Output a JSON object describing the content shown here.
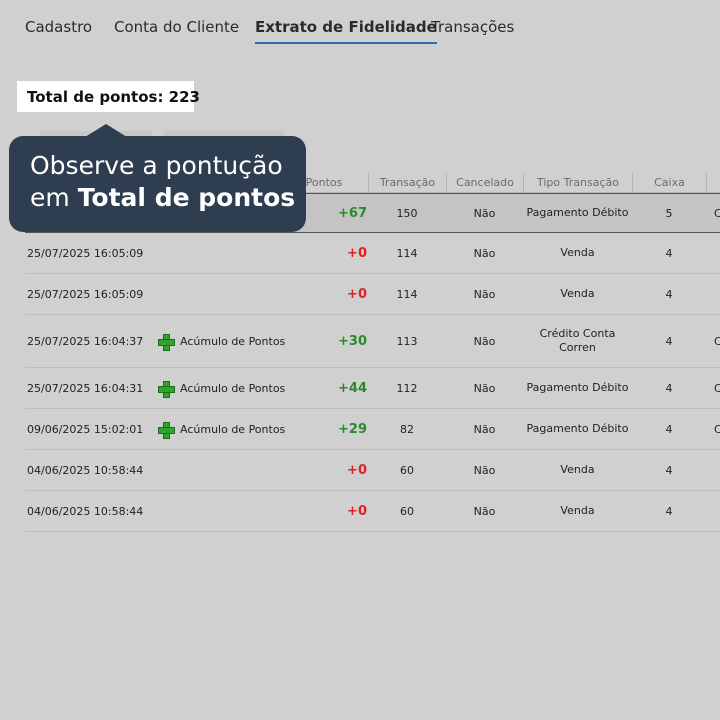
{
  "tabs": [
    {
      "label": "Cadastro"
    },
    {
      "label": "Conta do Cliente"
    },
    {
      "label": "Extrato de Fidelidade"
    },
    {
      "label": "Transações"
    }
  ],
  "total_points": "Total de pontos: 223",
  "tooltip": {
    "line1": "Observe a pontução",
    "line2_prefix": "em ",
    "line2_bold": "Total de pontos"
  },
  "table": {
    "headers": [
      "Pontos",
      "Transação",
      "Cancelado",
      "Tipo Transação",
      "Caixa"
    ],
    "rows": [
      {
        "date": "",
        "type": "",
        "points": "+67",
        "transaction": "150",
        "cancelled": "Não",
        "tipo": "Pagamento Débito",
        "caixa": "5",
        "extra": "C",
        "sign": "pos"
      },
      {
        "date": "25/07/2025 16:05:09",
        "type": "",
        "points": "+0",
        "transaction": "114",
        "cancelled": "Não",
        "tipo": "Venda",
        "caixa": "4",
        "extra": "",
        "sign": "neg"
      },
      {
        "date": "25/07/2025 16:05:09",
        "type": "",
        "points": "+0",
        "transaction": "114",
        "cancelled": "Não",
        "tipo": "Venda",
        "caixa": "4",
        "extra": "",
        "sign": "neg"
      },
      {
        "date": "25/07/2025 16:04:37",
        "type": "Acúmulo de Pontos",
        "points": "+30",
        "transaction": "113",
        "cancelled": "Não",
        "tipo": "Crédito Conta Corren",
        "caixa": "4",
        "extra": "C",
        "sign": "pos"
      },
      {
        "date": "25/07/2025 16:04:31",
        "type": "Acúmulo de Pontos",
        "points": "+44",
        "transaction": "112",
        "cancelled": "Não",
        "tipo": "Pagamento Débito",
        "caixa": "4",
        "extra": "C",
        "sign": "pos"
      },
      {
        "date": "09/06/2025 15:02:01",
        "type": "Acúmulo de Pontos",
        "points": "+29",
        "transaction": "82",
        "cancelled": "Não",
        "tipo": "Pagamento Débito",
        "caixa": "4",
        "extra": "C",
        "sign": "pos"
      },
      {
        "date": "04/06/2025 10:58:44",
        "type": "",
        "points": "+0",
        "transaction": "60",
        "cancelled": "Não",
        "tipo": "Venda",
        "caixa": "4",
        "extra": "",
        "sign": "neg"
      },
      {
        "date": "04/06/2025 10:58:44",
        "type": "",
        "points": "+0",
        "transaction": "60",
        "cancelled": "Não",
        "tipo": "Venda",
        "caixa": "4",
        "extra": "",
        "sign": "neg"
      }
    ]
  },
  "icons": {
    "accumulation": "plus-icon"
  },
  "colors": {
    "positive": "#2a8a2a",
    "negative": "#e02020",
    "tooltip_bg": "#2e3e50",
    "active_tab_underline": "#2a6fb5"
  }
}
